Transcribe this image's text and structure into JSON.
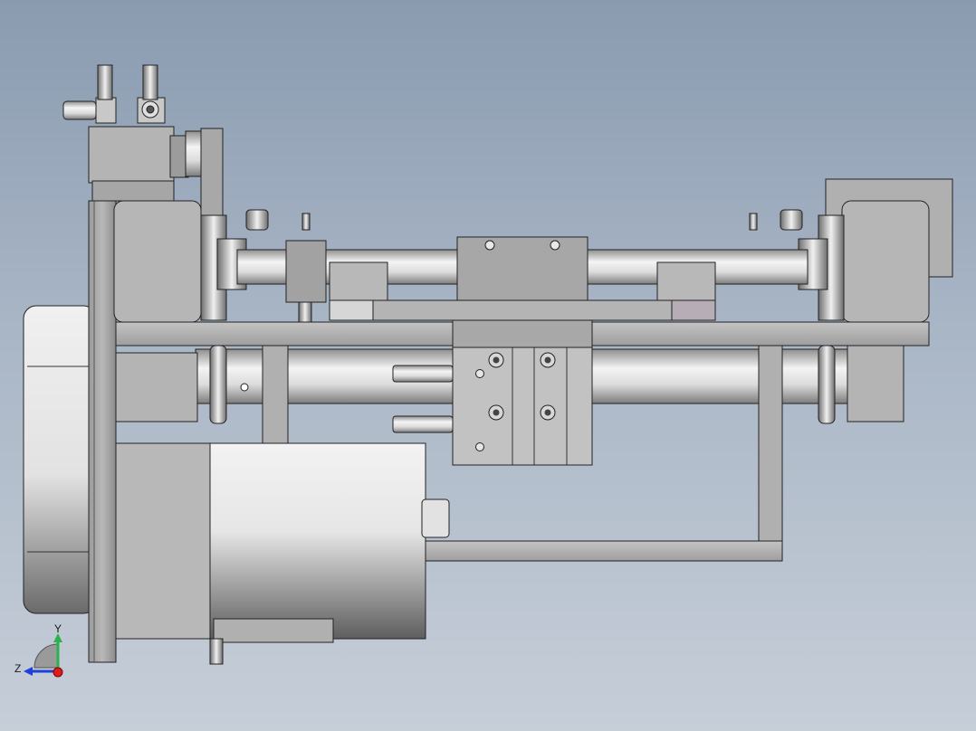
{
  "view": {
    "background_top": "#8a9bb0",
    "background_bottom": "#c6ced8"
  },
  "triad": {
    "y_label": "Y",
    "z_label": "Z",
    "y_color": "#2bb24c",
    "z_color": "#1f3fd6",
    "x_color": "#d81e1e"
  }
}
